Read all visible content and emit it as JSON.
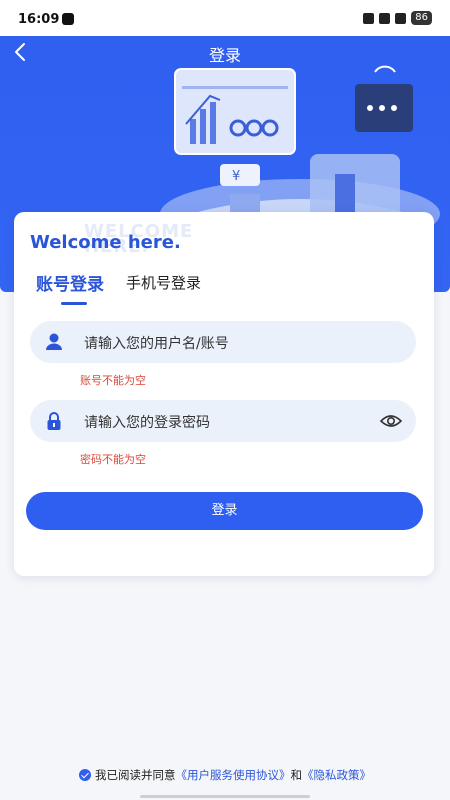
{
  "status_bar": {
    "time": "16:09",
    "battery": "86"
  },
  "nav": {
    "title": "登录"
  },
  "illustration": {
    "currency_symbol": "¥"
  },
  "card": {
    "welcome": "Welcome here.",
    "watermark_line1": "WELCOME",
    "watermark_line2": "HERE.",
    "tabs": [
      {
        "label": "账号登录",
        "active": true
      },
      {
        "label": "手机号登录",
        "active": false
      }
    ],
    "username": {
      "placeholder": "请输入您的用户名/账号",
      "error": "账号不能为空"
    },
    "password": {
      "placeholder": "请输入您的登录密码",
      "error": "密码不能为空"
    },
    "login_label": "登录"
  },
  "agreement": {
    "prefix": "我已阅读并同意",
    "terms": "《用户服务使用协议》",
    "and": "和",
    "privacy": "《隐私政策》"
  },
  "colors": {
    "primary": "#2f5ff0",
    "error": "#d94a3d",
    "field_bg": "#eaf1fb"
  },
  "icons": [
    "back-icon",
    "user-icon",
    "lock-icon",
    "eye-icon",
    "check-icon"
  ]
}
